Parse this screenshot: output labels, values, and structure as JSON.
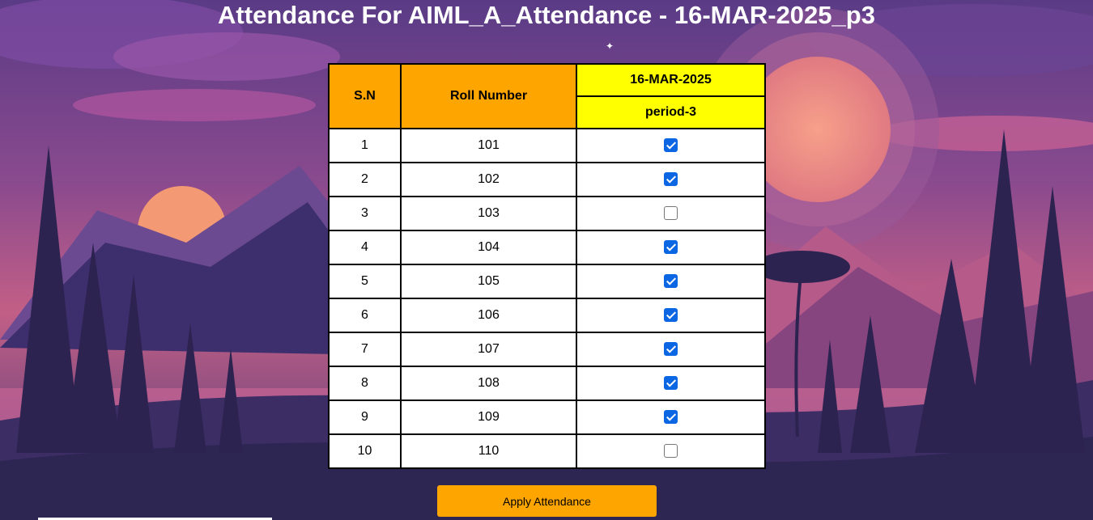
{
  "page": {
    "title": "Attendance For AIML_A_Attendance - 16-MAR-2025_p3"
  },
  "table": {
    "headers": {
      "sn": "S.N",
      "roll": "Roll Number",
      "date": "16-MAR-2025",
      "period": "period-3"
    },
    "rows": [
      {
        "sn": "1",
        "roll": "101",
        "present": true
      },
      {
        "sn": "2",
        "roll": "102",
        "present": true
      },
      {
        "sn": "3",
        "roll": "103",
        "present": false
      },
      {
        "sn": "4",
        "roll": "104",
        "present": true
      },
      {
        "sn": "5",
        "roll": "105",
        "present": true
      },
      {
        "sn": "6",
        "roll": "106",
        "present": true
      },
      {
        "sn": "7",
        "roll": "107",
        "present": true
      },
      {
        "sn": "8",
        "roll": "108",
        "present": true
      },
      {
        "sn": "9",
        "roll": "109",
        "present": true
      },
      {
        "sn": "10",
        "roll": "110",
        "present": false
      }
    ]
  },
  "actions": {
    "apply_label": "Apply Attendance"
  },
  "colors": {
    "header_orange": "#ffa500",
    "header_yellow": "#ffff00",
    "checkbox_checked": "#0b66e4",
    "button": "#ffa500"
  }
}
